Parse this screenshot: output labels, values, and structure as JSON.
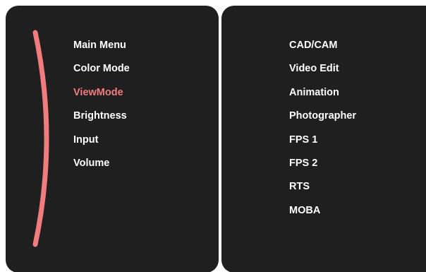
{
  "main_menu": {
    "items": [
      {
        "label": "Main Menu",
        "active": false
      },
      {
        "label": "Color Mode",
        "active": false
      },
      {
        "label": "ViewMode",
        "active": true
      },
      {
        "label": "Brightness",
        "active": false
      },
      {
        "label": "Input",
        "active": false
      },
      {
        "label": "Volume",
        "active": false
      }
    ]
  },
  "submenu": {
    "items": [
      {
        "label": "CAD/CAM"
      },
      {
        "label": "Video Edit"
      },
      {
        "label": "Animation"
      },
      {
        "label": "Photographer"
      },
      {
        "label": "FPS 1"
      },
      {
        "label": "FPS 2"
      },
      {
        "label": "RTS"
      },
      {
        "label": "MOBA"
      }
    ]
  },
  "colors": {
    "panel_bg": "#1f1f1f",
    "text": "#ffffff",
    "accent": "#f07c7e"
  }
}
